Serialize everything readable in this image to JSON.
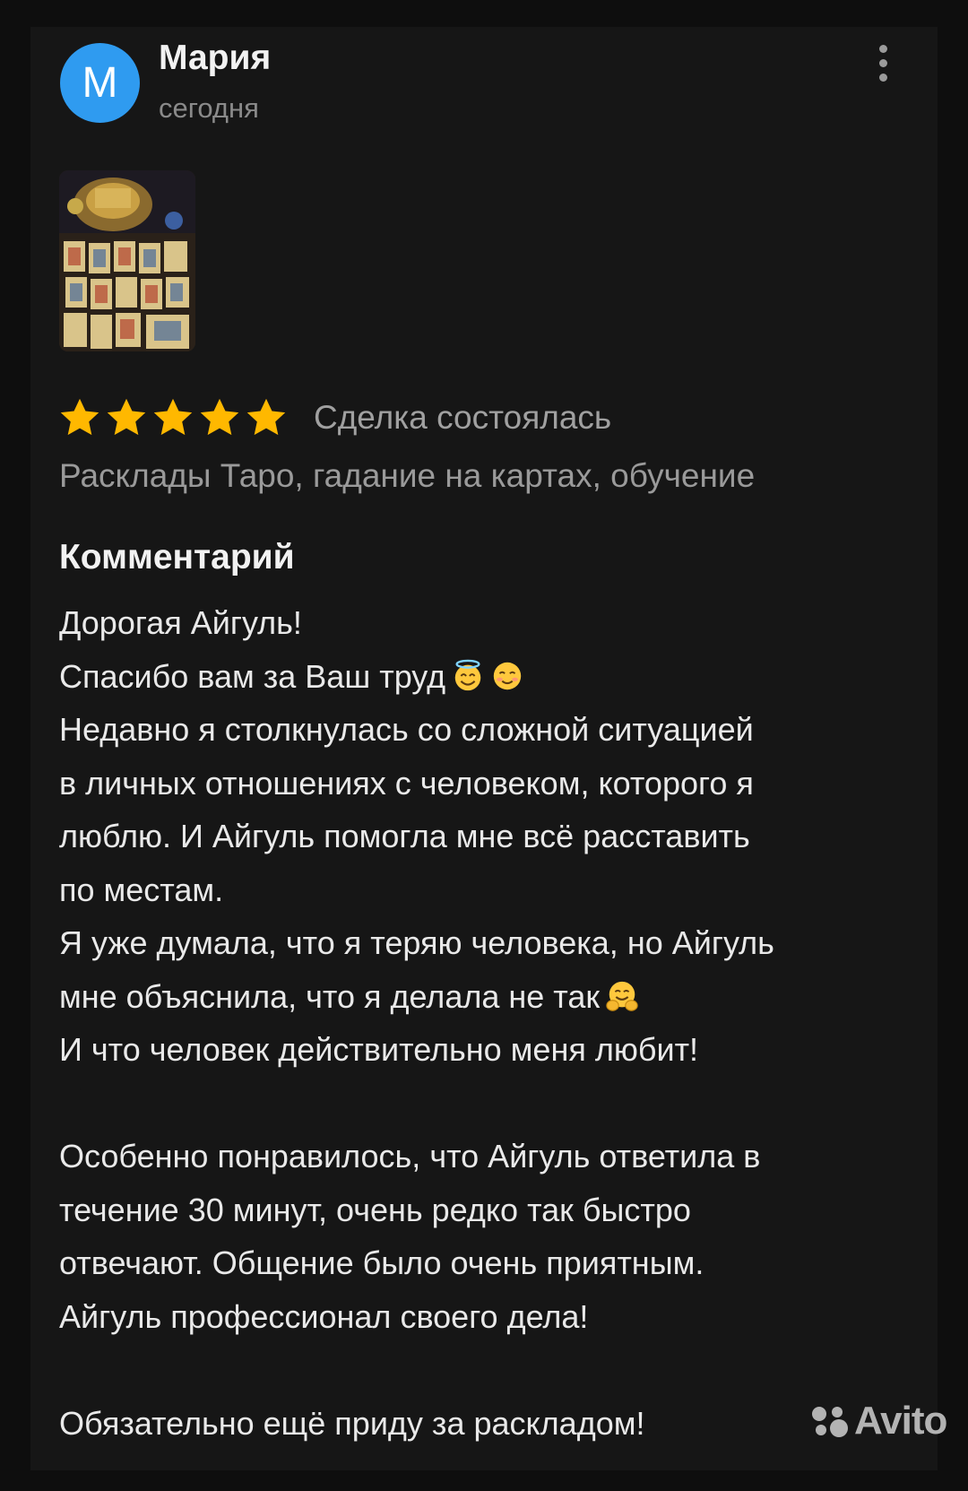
{
  "review": {
    "author": {
      "initial": "М",
      "name": "Мария",
      "date": "сегодня",
      "avatar_color": "#2f9bf0"
    },
    "rating": {
      "stars": 5,
      "max": 5,
      "star_color": "#ffb800",
      "status": "Сделка состоялась"
    },
    "category": "Расклады Таро, гадание на картах, обучение",
    "comment": {
      "heading": "Комментарий",
      "lines": [
        "Дорогая Айгуль!",
        "Спасибо вам за Ваш труд",
        "Недавно я столкнулась со сложной ситуацией",
        "в личных отношениях с человеком, которого я",
        "люблю. И Айгуль помогла мне всё расставить",
        "по местам.",
        "Я уже думала, что я теряю человека, но Айгуль",
        "мне объяснила, что я делала не так",
        "И что человек действительно меня любит!",
        "",
        "Особенно понравилось, что Айгуль ответила в",
        "течение 30 минут, очень редко так быстро",
        "отвечают. Общение было очень приятным.",
        "Айгуль профессионал своего дела!",
        "",
        "Обязательно ещё приду за раскладом!"
      ],
      "emojis": {
        "line_2": [
          "smiling-face-with-halo-emoji",
          "smiling-face-emoji"
        ],
        "line_8": [
          "hugging-face-emoji"
        ]
      }
    },
    "thumbnail": "tarot-cards-photo"
  },
  "watermark": {
    "text": "Avito"
  },
  "icons": {
    "more": "more-vertical-icon",
    "star": "star-icon"
  }
}
